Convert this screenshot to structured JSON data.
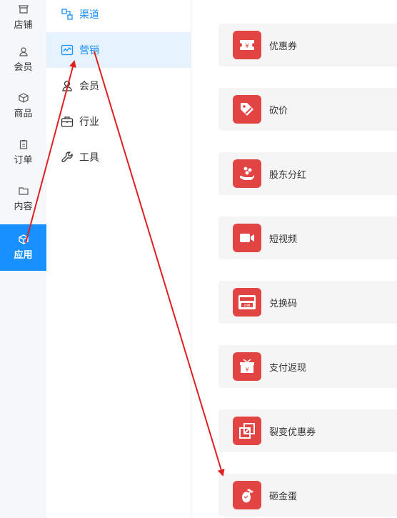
{
  "rail": {
    "items": [
      {
        "label": "店铺",
        "icon": "store-icon"
      },
      {
        "label": "会员",
        "icon": "user-icon"
      },
      {
        "label": "商品",
        "icon": "box-icon"
      },
      {
        "label": "订单",
        "icon": "clipboard-icon"
      },
      {
        "label": "内容",
        "icon": "folder-icon"
      },
      {
        "label": "应用",
        "icon": "cube-icon",
        "active": true
      }
    ]
  },
  "submenu": {
    "items": [
      {
        "label": "渠道",
        "icon": "channel-icon"
      },
      {
        "label": "营销",
        "icon": "chart-icon",
        "active": true
      },
      {
        "label": "会员",
        "icon": "user-icon"
      },
      {
        "label": "行业",
        "icon": "briefcase-icon"
      },
      {
        "label": "工具",
        "icon": "wrench-icon"
      }
    ]
  },
  "apps": [
    {
      "label": "优惠券",
      "icon": "coupon-icon"
    },
    {
      "label": "砍价",
      "icon": "price-tag-icon"
    },
    {
      "label": "股东分红",
      "icon": "dividend-hand-icon"
    },
    {
      "label": "短视频",
      "icon": "video-camera-icon"
    },
    {
      "label": "兑换码",
      "icon": "redeem-code-icon",
      "badge": "兑换"
    },
    {
      "label": "支付返现",
      "icon": "cashback-box-icon"
    },
    {
      "label": "裂变优惠券",
      "icon": "fission-link-icon"
    },
    {
      "label": "砸金蛋",
      "icon": "golden-egg-icon"
    }
  ],
  "colors": {
    "accent": "#1890ff",
    "appIcon": "#e24444",
    "annotation": "#e02020"
  }
}
